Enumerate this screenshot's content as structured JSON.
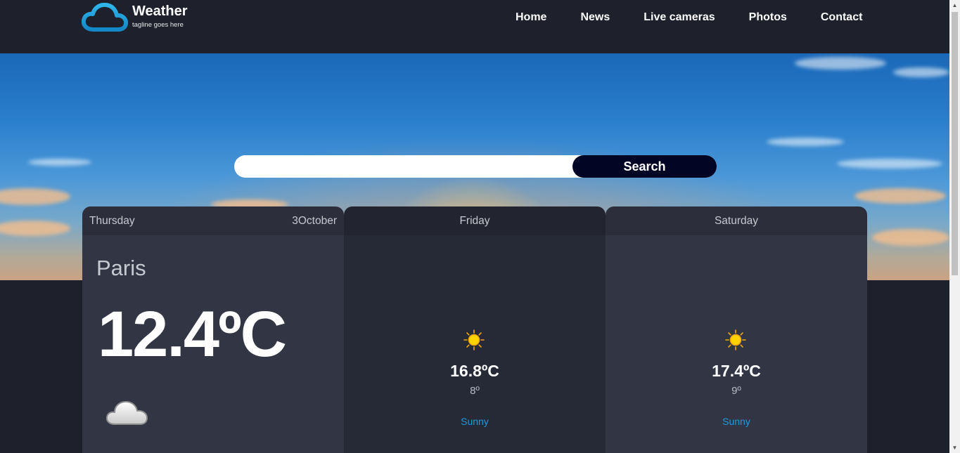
{
  "header": {
    "site_title": "Weather",
    "tagline": "tagline goes here",
    "nav": [
      "Home",
      "News",
      "Live cameras",
      "Photos",
      "Contact"
    ]
  },
  "search": {
    "value": "",
    "placeholder": "",
    "button_label": "Search"
  },
  "forecast": {
    "today": {
      "day": "Thursday",
      "date": "3October",
      "city": "Paris",
      "temp": "12.4ºC",
      "icon": "cloud-icon"
    },
    "days": [
      {
        "day": "Friday",
        "temp": "16.8ºC",
        "min": "8º",
        "desc": "Sunny",
        "icon": "sun-icon"
      },
      {
        "day": "Saturday",
        "temp": "17.4ºC",
        "min": "9º",
        "desc": "Sunny",
        "icon": "sun-icon"
      }
    ]
  },
  "colors": {
    "background": "#1e202b",
    "card": "#323544",
    "card_alt": "#262936",
    "accent_blue": "#1f9bd9",
    "search_button": "#020524",
    "logo_blue": "#1a9fd8"
  }
}
